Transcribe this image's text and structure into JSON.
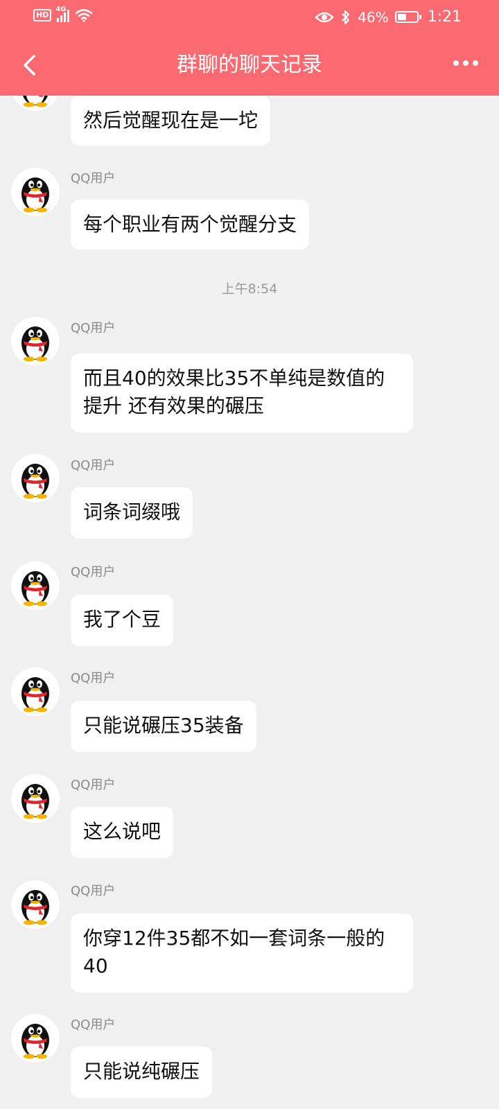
{
  "status_bar": {
    "hd": "HD",
    "network": "4G",
    "battery": "46%",
    "battery_level": 0.46,
    "time": "1:21"
  },
  "header": {
    "title": "群聊的聊天记录",
    "back_icon": "chevron-left-icon",
    "more_icon": "more-dots-icon"
  },
  "colors": {
    "accent": "#fc6a71",
    "background": "#f0f0f0",
    "bubble": "#ffffff"
  },
  "messages": [
    {
      "sender": "",
      "text": "然后觉醒现在是一坨"
    },
    {
      "sender": "QQ用户",
      "text": "每个职业有两个觉醒分支"
    },
    {
      "time": "上午8:54"
    },
    {
      "sender": "QQ用户",
      "text": "而且40的效果比35不单纯是数值的提升 还有效果的碾压"
    },
    {
      "sender": "QQ用户",
      "text": "词条词缀哦"
    },
    {
      "sender": "QQ用户",
      "text": "我了个豆"
    },
    {
      "sender": "QQ用户",
      "text": "只能说碾压35装备"
    },
    {
      "sender": "QQ用户",
      "text": "这么说吧"
    },
    {
      "sender": "QQ用户",
      "text": "你穿12件35都不如一套词条一般的40"
    },
    {
      "sender": "QQ用户",
      "text": "只能说纯碾压"
    }
  ]
}
